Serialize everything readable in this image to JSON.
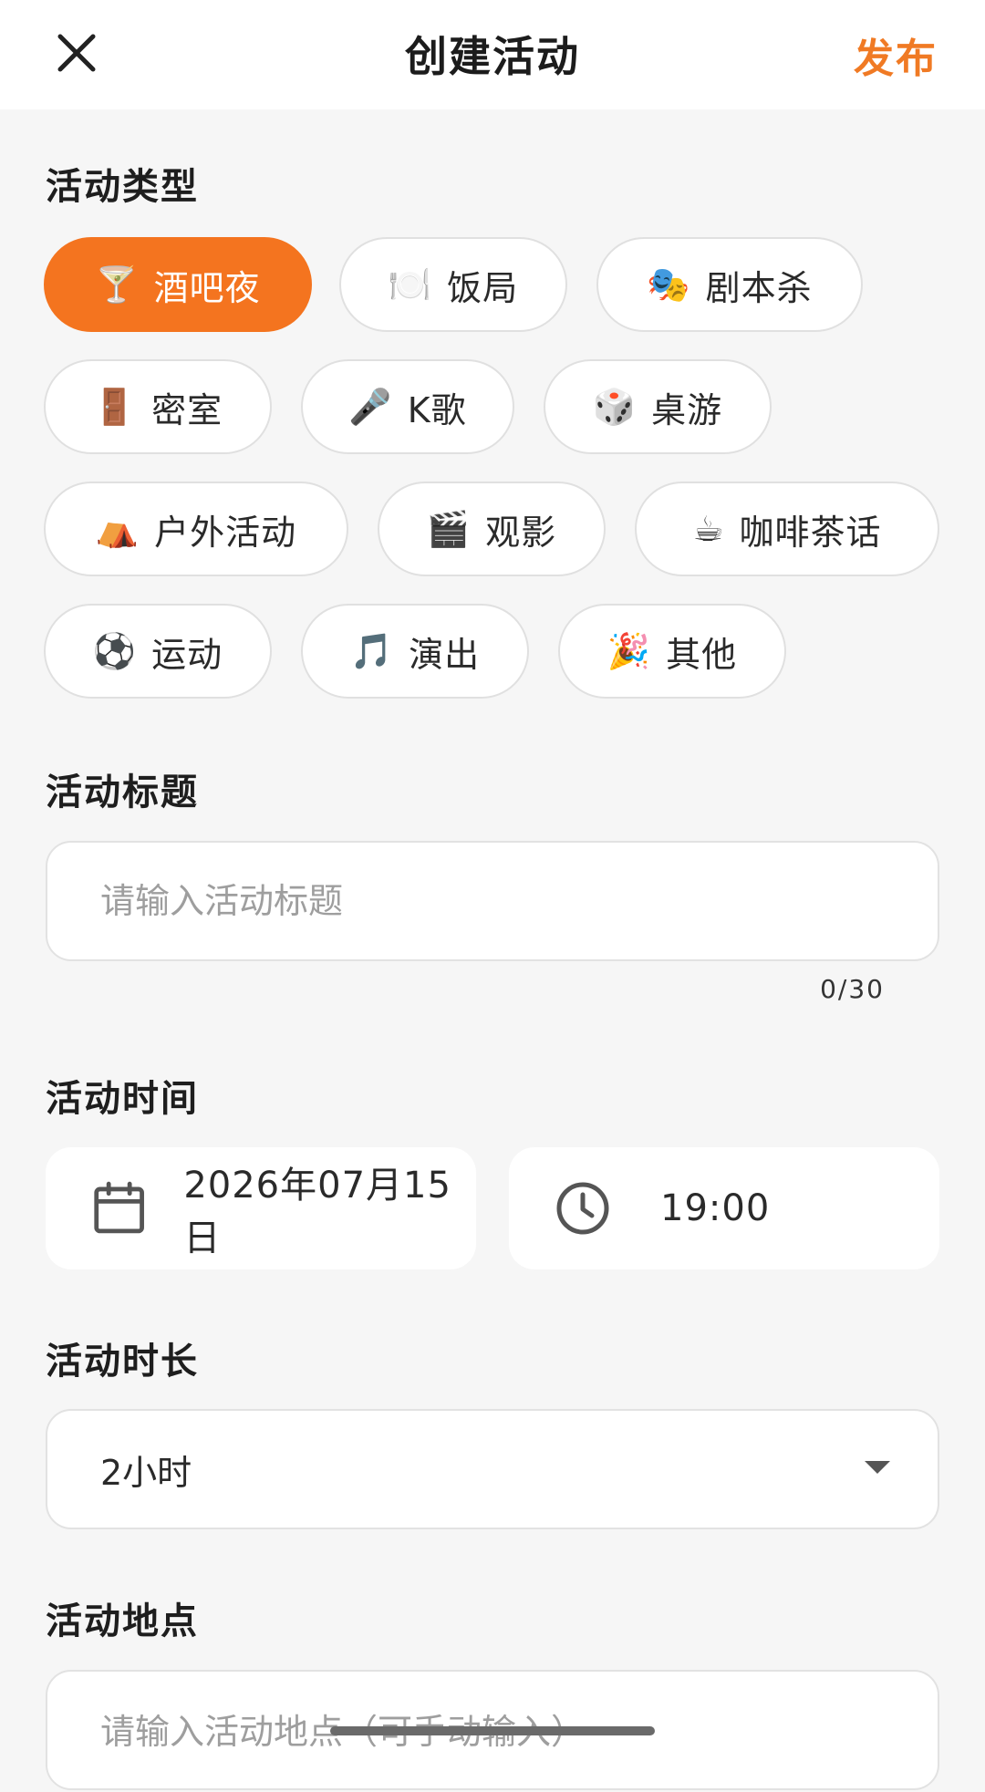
{
  "header": {
    "title": "创建活动",
    "publish_label": "发布",
    "close_icon": "close-icon"
  },
  "activity_type": {
    "label": "活动类型",
    "selected": "酒吧夜",
    "accent_color": "#f4741f",
    "options": [
      {
        "icon": "🍸",
        "icon_name": "cocktail-icon",
        "label": "酒吧夜"
      },
      {
        "icon": "🍽️",
        "icon_name": "plate-icon",
        "label": "饭局"
      },
      {
        "icon": "🎭",
        "icon_name": "theater-masks-icon",
        "label": "剧本杀"
      },
      {
        "icon": "🚪",
        "icon_name": "door-icon",
        "label": "密室"
      },
      {
        "icon": "🎤",
        "icon_name": "microphone-icon",
        "label": "K歌"
      },
      {
        "icon": "🎲",
        "icon_name": "dice-icon",
        "label": "桌游"
      },
      {
        "icon": "⛺",
        "icon_name": "tent-icon",
        "label": "户外活动"
      },
      {
        "icon": "🎬",
        "icon_name": "clapper-icon",
        "label": "观影"
      },
      {
        "icon": "☕",
        "icon_name": "coffee-icon",
        "label": "咖啡茶话"
      },
      {
        "icon": "⚽",
        "icon_name": "soccer-ball-icon",
        "label": "运动"
      },
      {
        "icon": "🎵",
        "icon_name": "music-note-icon",
        "label": "演出"
      },
      {
        "icon": "🎉",
        "icon_name": "party-popper-icon",
        "label": "其他"
      }
    ]
  },
  "activity_title": {
    "label": "活动标题",
    "placeholder": "请输入活动标题",
    "value": "",
    "counter": "0/30"
  },
  "activity_time": {
    "label": "活动时间",
    "date": "2026年07月15日",
    "date_icon": "calendar-icon",
    "time": "19:00",
    "time_icon": "clock-icon"
  },
  "activity_duration": {
    "label": "活动时长",
    "value": "2小时",
    "dropdown_icon": "dropdown-arrow-icon"
  },
  "activity_location": {
    "label": "活动地点",
    "placeholder": "请输入活动地点（可手动输入）"
  }
}
